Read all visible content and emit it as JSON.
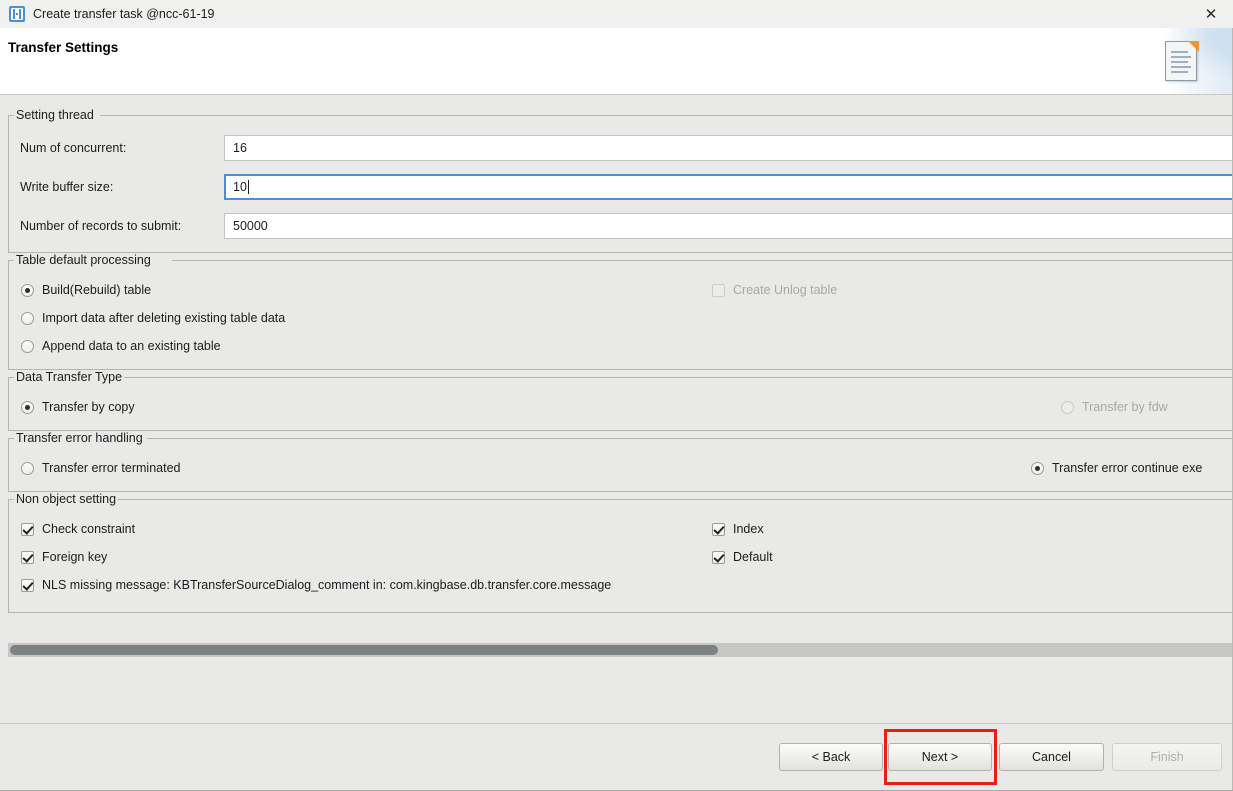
{
  "window": {
    "title": "Create transfer task @ncc-61-19",
    "icon": "transfer-app-icon",
    "close_label": "✕"
  },
  "header": {
    "title": "Transfer Settings",
    "icon": "document-icon"
  },
  "groups": {
    "setting_thread": {
      "label": "Setting thread",
      "fields": [
        {
          "label": "Num of concurrent:",
          "value": "16",
          "focused": false
        },
        {
          "label": "Write buffer size:",
          "value": "10",
          "focused": true
        },
        {
          "label": "Number of records to submit:",
          "value": "50000",
          "focused": false
        }
      ]
    },
    "table_default_processing": {
      "label": "Table default processing",
      "radios": [
        {
          "label": "Build(Rebuild) table",
          "checked": true,
          "disabled": false
        },
        {
          "label": "Import data after deleting existing table data",
          "checked": false,
          "disabled": false
        },
        {
          "label": "Append data to an existing table",
          "checked": false,
          "disabled": false
        }
      ],
      "checkbox": {
        "label": "Create Unlog table",
        "checked": false,
        "disabled": true
      }
    },
    "data_transfer_type": {
      "label": "Data Transfer Type",
      "radios": [
        {
          "label": "Transfer by copy",
          "checked": true,
          "disabled": false
        },
        {
          "label": "Transfer by fdw",
          "checked": false,
          "disabled": true
        }
      ]
    },
    "transfer_error_handling": {
      "label": "Transfer error handling",
      "radios": [
        {
          "label": "Transfer error terminated",
          "checked": false,
          "disabled": false
        },
        {
          "label": "Transfer error continue exe",
          "checked": true,
          "disabled": false
        }
      ]
    },
    "non_object_setting": {
      "label": "Non object setting",
      "checkboxes": [
        {
          "label": "Check constraint",
          "checked": true
        },
        {
          "label": "Index",
          "checked": true
        },
        {
          "label": "Foreign key",
          "checked": true
        },
        {
          "label": "Default",
          "checked": true
        },
        {
          "label": "NLS missing message: KBTransferSourceDialog_comment in: com.kingbase.db.transfer.core.message",
          "checked": true
        }
      ]
    }
  },
  "scrollbar": {
    "orientation": "horizontal",
    "thumb_fraction_percent": 58
  },
  "buttons": {
    "back": {
      "label": "< Back",
      "disabled": false
    },
    "next": {
      "label": "Next >",
      "disabled": false,
      "highlighted": true
    },
    "cancel": {
      "label": "Cancel",
      "disabled": false
    },
    "finish": {
      "label": "Finish",
      "disabled": true
    }
  },
  "colors": {
    "background": "#e9e9e7",
    "header_background": "#ffffff",
    "focus_border": "#4a90d9",
    "annotation": "#e8200f",
    "disabled_text": "#a8a8a4",
    "scroll_thumb": "#7e8183"
  }
}
